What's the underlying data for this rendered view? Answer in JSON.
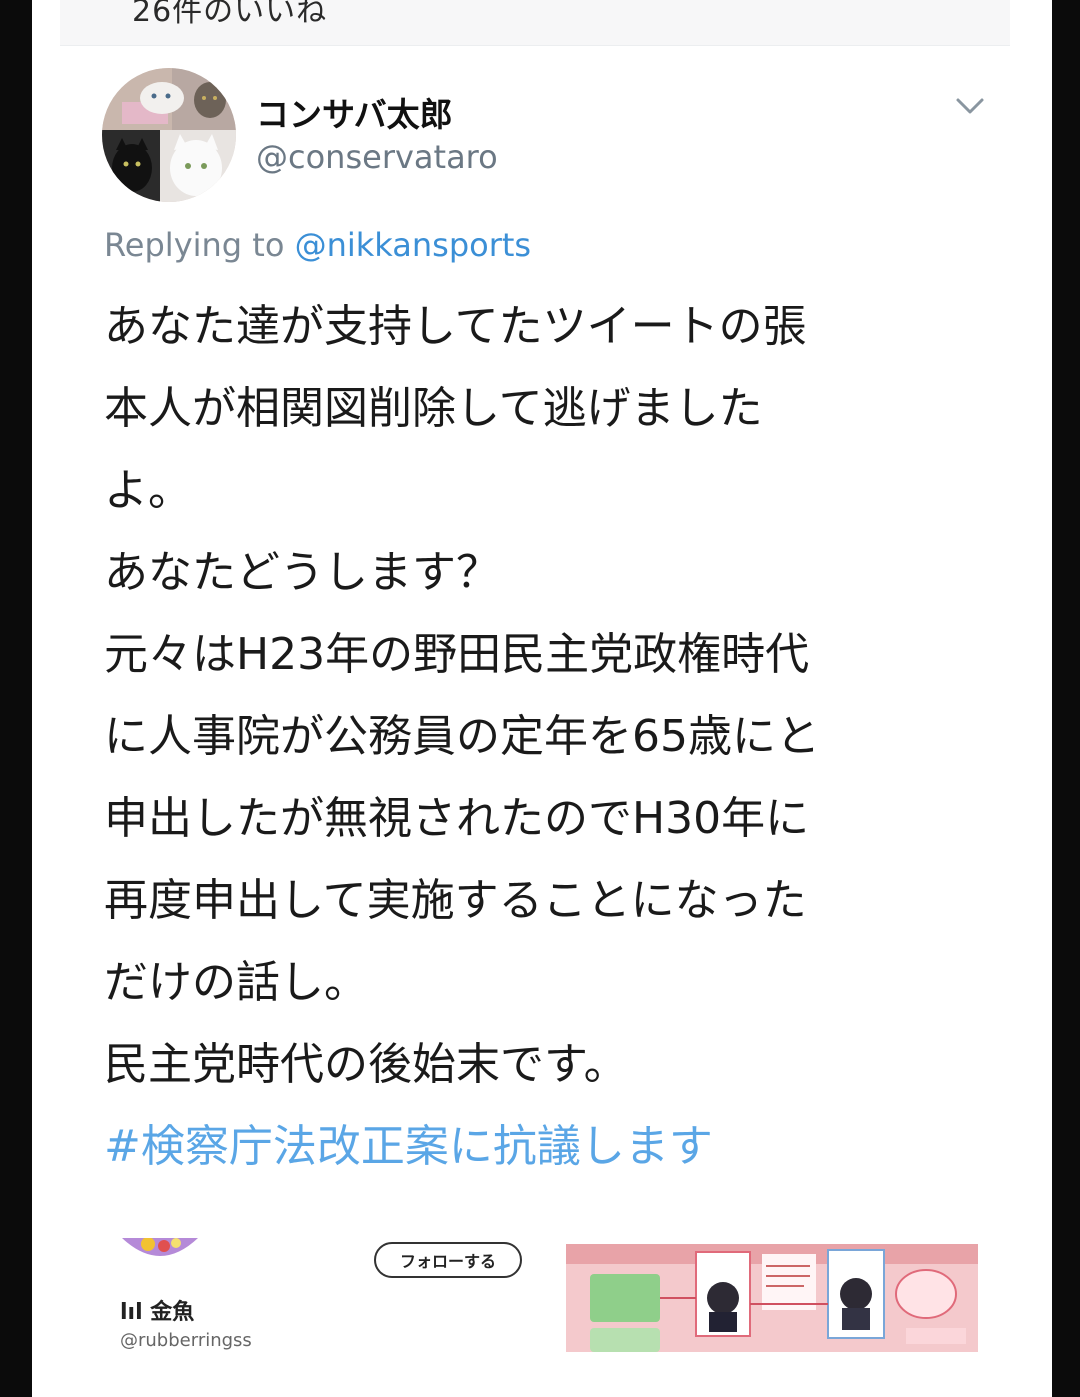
{
  "previous_tweet": {
    "likes_text": "26件のいいね"
  },
  "tweet": {
    "display_name": "コンサバ太郎",
    "handle": "@conservataro",
    "reply_prefix": "Replying to",
    "reply_mention": "@nikkansports",
    "body_lines": [
      "あなた達が支持してたツイートの張",
      "本人が相関図削除して逃げました",
      "よ。",
      "あなたどうします？",
      "元々はH23年の野田民主党政権時代",
      "に人事院が公務員の定年を65歳にと",
      "申出したが無視されたのでH30年に",
      "再度申出して実施することになった",
      "だけの話し。",
      "民主党時代の後始末です。"
    ],
    "hashtag": "#検察庁法改正案に抗議します"
  },
  "embed": {
    "name": "lıl 金魚",
    "handle": "@rubberringss",
    "follow_label": "フォローする"
  },
  "colors": {
    "link_blue": "#3b8fd6",
    "hashtag_blue": "#5aa6e6",
    "muted": "#6b7884"
  },
  "icons": {
    "menu": "chevron-down-icon"
  }
}
